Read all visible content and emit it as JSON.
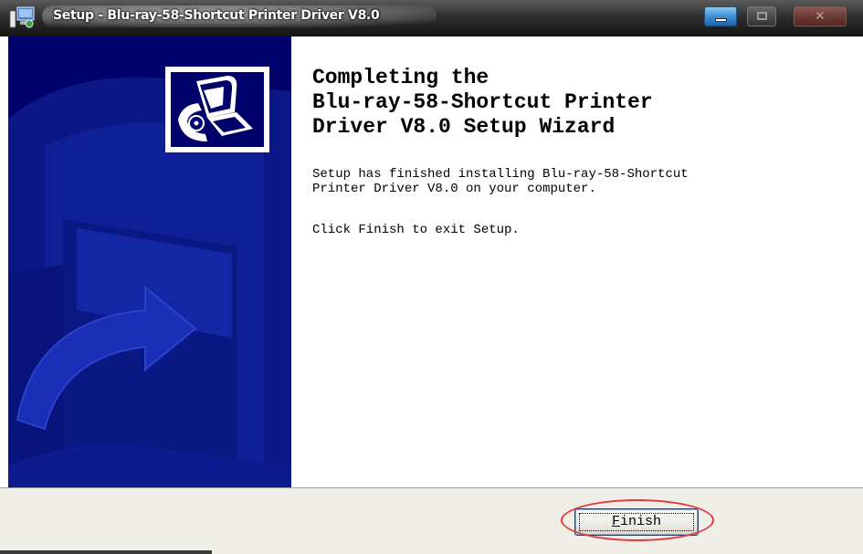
{
  "window": {
    "title": "Setup - Blu-ray-58-Shortcut Printer Driver V8.0",
    "controls": {
      "minimize_icon": "minimize-icon",
      "maximize_icon": "maximize-icon",
      "close_icon": "close-icon",
      "close_glyph": "✕"
    }
  },
  "wizard": {
    "heading": "Completing the\nBlu-ray-58-Shortcut Printer\nDriver V8.0 Setup Wizard",
    "message": "Setup has finished installing Blu-ray-58-Shortcut\nPrinter Driver V8.0 on your computer.",
    "instruction": "Click Finish to exit Setup.",
    "banner_logo": "printer-setup-icon"
  },
  "footer": {
    "finish_accel": "F",
    "finish_rest": "inish"
  },
  "colors": {
    "banner": "#00006b",
    "banner_art": "#0c1a85",
    "annotation": "#e23a3a"
  }
}
